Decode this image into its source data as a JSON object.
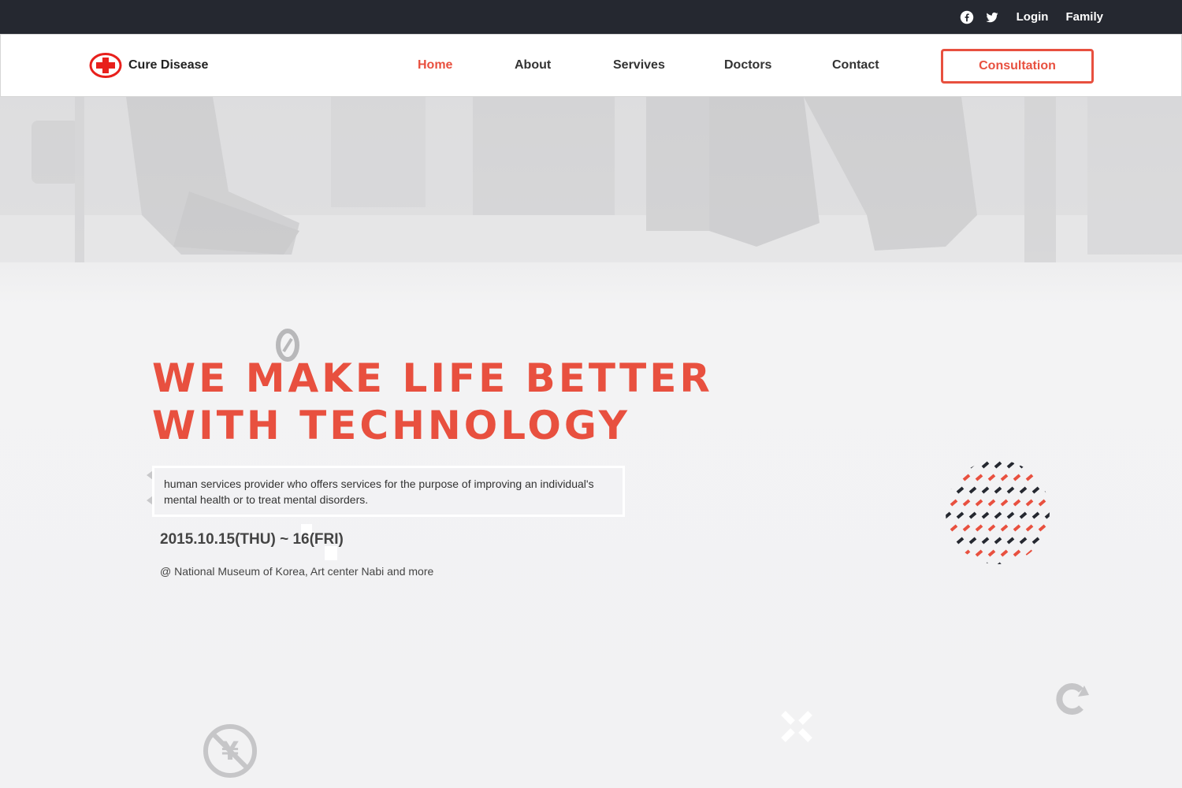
{
  "topbar": {
    "links": [
      {
        "icon": "facebook-icon"
      },
      {
        "icon": "twitter-icon"
      }
    ],
    "login_label": "Login",
    "family_label": "Family"
  },
  "header": {
    "logo_text": "Cure Disease",
    "nav": [
      {
        "label": "Home",
        "active": true
      },
      {
        "label": "About",
        "active": false
      },
      {
        "label": "Servives",
        "active": false
      },
      {
        "label": "Doctors",
        "active": false
      },
      {
        "label": "Contact",
        "active": false
      }
    ],
    "cta_label": "Consultation"
  },
  "hero": {
    "title_line1": "WE MAKE LIFE BETTER",
    "title_line2": "WITH TECHNOLOGY",
    "description": "human services provider who offers services for the purpose of improving an individual's mental health or to treat mental disorders.",
    "date": "2015.10.15(THU) ~ 16(FRI)",
    "venue": "@ National Museum of Korea, Art center Nabi and more"
  },
  "colors": {
    "accent": "#e8503f",
    "topbar_bg": "#252830",
    "hero_bg": "#f2f2f3"
  }
}
